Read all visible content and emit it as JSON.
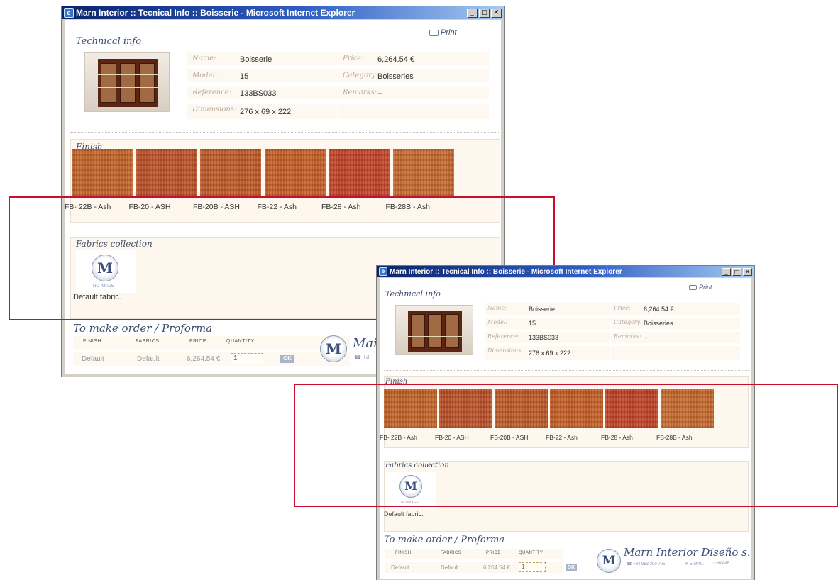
{
  "window": {
    "title": "Marn Interior :: Tecnical Info :: Boisserie - Microsoft Internet Explorer",
    "title_icon": "e",
    "minimize_icon": "minimize-icon",
    "maximize_icon": "maximize-icon",
    "close_icon": "close-icon"
  },
  "page": {
    "print_label": "Print",
    "technical_heading": "Technical info",
    "fields": {
      "name_label": "Name:",
      "name_value": "Boisserie",
      "model_label": "Model:",
      "model_value": "15",
      "reference_label": "Reference:",
      "reference_value": "133BS033",
      "dimensions_label": "Dimensions:",
      "dimensions_value": "276 x 69 x 222",
      "price_label": "Price:",
      "price_value": "6,264.54 €",
      "category_label": "Category:",
      "category_value": "Boisseries",
      "remarks_label": "Remarks:",
      "remarks_value": "--"
    },
    "finish_heading": "Finish",
    "finishes": [
      {
        "label": "FB- 22B - Ash",
        "color": "#c0642a"
      },
      {
        "label": "FB-20 - ASH",
        "color": "#b8502a"
      },
      {
        "label": "FB-20B - ASH",
        "color": "#bb5a2a"
      },
      {
        "label": "FB-22 - Ash",
        "color": "#c25e28"
      },
      {
        "label": "FB-28 - Ash",
        "color": "#c0402a"
      },
      {
        "label": "FB-28B - Ash",
        "color": "#c46a30"
      }
    ],
    "fabrics_heading": "Fabrics collection",
    "logo_letter": "M",
    "no_image_label": "no image",
    "default_fabric": "Default fabric.",
    "order_heading": "To make order / Proforma",
    "order_headers": {
      "finish": "FINISH",
      "fabrics": "FABRICS",
      "price": "PRICE",
      "quantity": "QUANTITY"
    },
    "order_row": {
      "finish": "Default",
      "fabrics": "Default",
      "price": "6,264.54 €",
      "quantity": "1"
    },
    "ok_label": "OK",
    "brand_name": "Marn Interior Diseño s.l.",
    "brand_cropped": "Mai",
    "phone_cropped": "☎ +3",
    "phone": "☎ +34 953 300 705",
    "email": "✉ E-MAIL",
    "home": "⌂ HOME"
  },
  "colors": {
    "highlight": "#c8102e",
    "heading": "#3e4f6e",
    "title_bar": "#0a246a"
  }
}
